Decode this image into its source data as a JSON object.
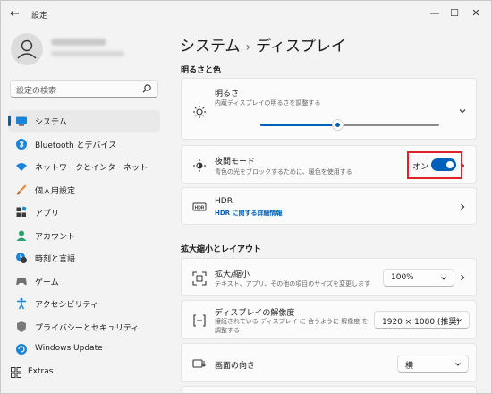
{
  "window": {
    "title": "設定",
    "controls": {
      "minimize": "—",
      "maximize": "☐",
      "close": "✕"
    }
  },
  "search": {
    "placeholder": "設定の検索"
  },
  "sidebar": {
    "items": [
      {
        "label": "システム",
        "icon": "system-icon",
        "active": true
      },
      {
        "label": "Bluetooth とデバイス",
        "icon": "bluetooth-icon"
      },
      {
        "label": "ネットワークとインターネット",
        "icon": "wifi-icon"
      },
      {
        "label": "個人用設定",
        "icon": "brush-icon"
      },
      {
        "label": "アプリ",
        "icon": "apps-icon"
      },
      {
        "label": "アカウント",
        "icon": "account-icon"
      },
      {
        "label": "時刻と言語",
        "icon": "time-language-icon"
      },
      {
        "label": "ゲーム",
        "icon": "gaming-icon"
      },
      {
        "label": "アクセシビリティ",
        "icon": "accessibility-icon"
      },
      {
        "label": "プライバシーとセキュリティ",
        "icon": "shield-icon"
      },
      {
        "label": "Windows Update",
        "icon": "update-icon"
      }
    ],
    "extras": "Extras"
  },
  "breadcrumb": {
    "parent": "システム",
    "separator": "›",
    "current": "ディスプレイ"
  },
  "sections": {
    "brightness_color": "明るさと色",
    "scale_layout": "拡大縮小とレイアウト"
  },
  "brightness": {
    "title": "明るさ",
    "subtitle": "内蔵ディスプレイの明るさを調整する",
    "level": 0.43
  },
  "night_light": {
    "title": "夜間モード",
    "subtitle": "青色の光をブロックするために、暖色を使用する",
    "toggle_label": "オン",
    "on": true
  },
  "hdr": {
    "title": "HDR",
    "link": "HDR に関する詳細情報"
  },
  "scale": {
    "title": "拡大/縮小",
    "subtitle": "テキスト、アプリ、その他の項目のサイズを変更します",
    "value": "100%"
  },
  "resolution": {
    "title": "ディスプレイの解像度",
    "subtitle": "接続されている ディスプレイ に 合うように 解像度 を 調整する",
    "value": "1920 × 1080 (推奨)"
  },
  "orientation": {
    "title": "画面の向き",
    "value": "横"
  },
  "colors": {
    "accent": "#005fb8",
    "highlight_box": "#e0202a"
  }
}
